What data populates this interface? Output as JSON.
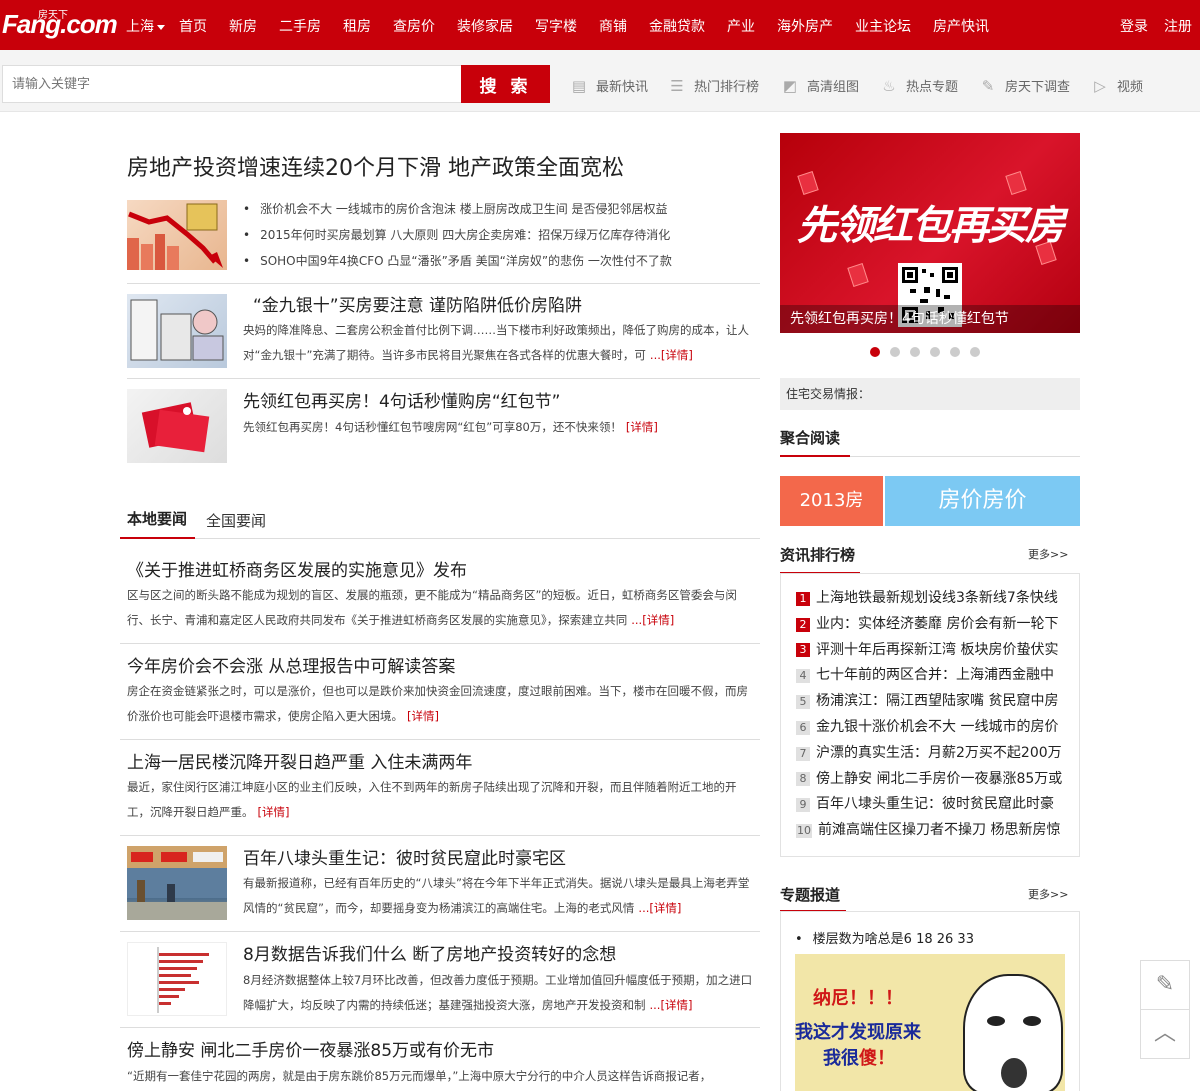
{
  "nav": {
    "logo_main": "Fang.com",
    "logo_sub": "房天下",
    "city": "上海",
    "links": [
      "首页",
      "新房",
      "二手房",
      "租房",
      "查房价",
      "装修家居",
      "写字楼",
      "商铺",
      "金融贷款",
      "产业",
      "海外房产",
      "业主论坛",
      "房产快讯"
    ],
    "login": "登录",
    "register": "注册"
  },
  "search": {
    "placeholder": "请输入关键字",
    "button": "搜 索"
  },
  "quick_links": [
    {
      "label": "最新快讯",
      "icon": "list-icon"
    },
    {
      "label": "热门排行榜",
      "icon": "ranking-icon"
    },
    {
      "label": "高清组图",
      "icon": "chart-icon"
    },
    {
      "label": "热点专题",
      "icon": "fire-icon"
    },
    {
      "label": "房天下调查",
      "icon": "survey-icon"
    },
    {
      "label": "视频",
      "icon": "play-icon"
    }
  ],
  "headline": {
    "title": "房地产投资增速连续20个月下滑 地产政策全面宽松",
    "bullets": [
      "涨价机会不大 一线城市的房价含泡沫 楼上厨房改成卫生间 是否侵犯邻居权益",
      "2015年何时买房最划算 八大原则 四大房企卖房难：招保万绿万亿库存待消化",
      "SOHO中国9年4换CFO 凸显“潘张”矛盾 美国“洋房奴”的悲伤 一次性付不了款"
    ]
  },
  "features": [
    {
      "title": "“金九银十”买房要注意 谨防陷阱低价房陷阱",
      "desc": "央妈的降准降息、二套房公积金首付比例下调……当下楼市利好政策频出，降低了购房的成本，让人对“金九银十”充满了期待。当许多市民将目光聚焦在各式各样的优惠大餐时，可",
      "more": "...[详情]"
    },
    {
      "title": "先领红包再买房！4句话秒懂购房“红包节”",
      "desc": "先领红包再买房！4句话秒懂红包节嗖房网“红包”可享80万，还不快来领！",
      "more": "[详情]"
    }
  ],
  "tabs": {
    "active": "本地要闻",
    "other": "全国要闻"
  },
  "news": [
    {
      "title": "《关于推进虹桥商务区发展的实施意见》发布",
      "desc": "区与区之间的断头路不能成为规划的盲区、发展的瓶颈，更不能成为“精品商务区”的短板。近日，虹桥商务区管委会与闵行、长宁、青浦和嘉定区人民政府共同发布《关于推进虹桥商务区发展的实施意见》，探索建立共同",
      "more": "...[详情]"
    },
    {
      "title": "今年房价会不会涨 从总理报告中可解读答案",
      "desc": "房企在资金链紧张之时，可以是涨价，但也可以是跌价来加快资金回流速度，度过眼前困难。当下，楼市在回暖不假，而房价涨价也可能会吓退楼市需求，使房企陷入更大困境。",
      "more": "[详情]"
    },
    {
      "title": "上海一居民楼沉降开裂日趋严重 入住未满两年",
      "desc": "最近，家住闵行区浦江坤庭小区的业主们反映，入住不到两年的新房子陆续出现了沉降和开裂，而且伴随着附近工地的开工，沉降开裂日趋严重。",
      "more": "[详情]"
    },
    {
      "title": "百年八埭头重生记：彼时贫民窟此时豪宅区",
      "desc": "有最新报道称，已经有百年历史的“八埭头”将在今年下半年正式消失。据说八埭头是最具上海老弄堂风情的“贫民窟”，而今，却要摇身变为杨浦滨江的高端住宅。上海的老式风情",
      "more": "...[详情]"
    },
    {
      "title": "8月数据告诉我们什么 断了房地产投资转好的念想",
      "desc": "8月经济数据整体上较7月环比改善，但改善力度低于预期。工业增加值回升幅度低于预期，加之进口降幅扩大，均反映了内需的持续低迷；基建强拙投资大涨，房地产开发投资和制",
      "more": "...[详情]"
    },
    {
      "title": "傍上静安 闸北二手房价一夜暴涨85万或有价无市",
      "desc": "“近期有一套佳宁花园的两房，就是由于房东跳价85万元而爆单，”上海中原大宁分行的中介人员这样告诉商报记者，",
      "more": ""
    }
  ],
  "banner": {
    "text": "先领红包再买房",
    "caption": "先领红包再买房！4句话秒懂红包节",
    "dots": 6,
    "active_dot": 1
  },
  "trade_info": "住宅交易情报：",
  "reading": {
    "title": "聚合阅读",
    "tile1": "2013房",
    "tile2": "房价房价"
  },
  "ranking": {
    "title": "资讯排行榜",
    "more": "更多>>",
    "items": [
      {
        "num": "1",
        "text": "上海地铁最新规划设线3条新线7条快线"
      },
      {
        "num": "2",
        "text": "业内：实体经济萎靡 房价会有新一轮下"
      },
      {
        "num": "3",
        "text": "评测十年后再探新江湾 板块房价蛰伏实"
      },
      {
        "num": "4",
        "text": "七十年前的两区合并：上海浦西金融中"
      },
      {
        "num": "5",
        "text": "杨浦滨江：隔江西望陆家嘴 贫民窟中房"
      },
      {
        "num": "6",
        "text": "金九银十涨价机会不大 一线城市的房价"
      },
      {
        "num": "7",
        "text": "沪漂的真实生活：月薪2万买不起200万"
      },
      {
        "num": "8",
        "text": "傍上静安 闸北二手房价一夜暴涨85万或"
      },
      {
        "num": "9",
        "text": "百年八埭头重生记：彼时贫民窟此时豪"
      },
      {
        "num": "10",
        "text": "前滩高端住区操刀者不操刀 杨思新房惊"
      }
    ]
  },
  "topics": {
    "title": "专题报道",
    "more": "更多>>",
    "item": "楼层数为啥总是6 18 26 33",
    "img_line1": "纳尼！！！",
    "img_line2": "我这才发现原来",
    "img_line3a": "我很",
    "img_line3b": "傻！"
  },
  "colors": {
    "brand": "#c8000a",
    "tile1": "#f3684b",
    "tile2": "#7cc9f3"
  }
}
